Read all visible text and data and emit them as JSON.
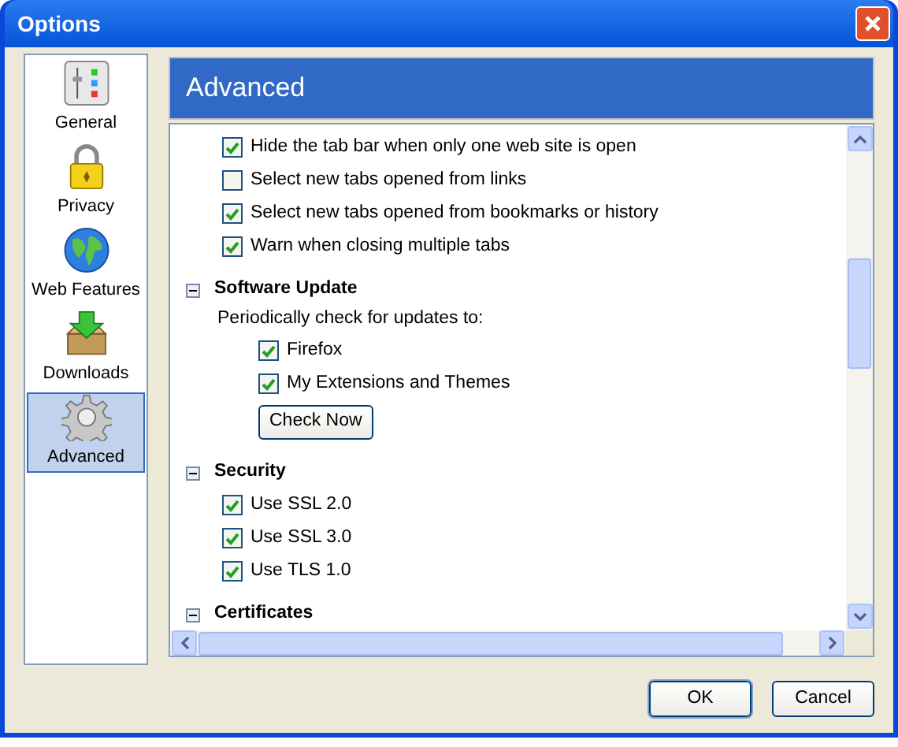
{
  "window": {
    "title": "Options"
  },
  "sidebar": {
    "items": [
      {
        "label": "General",
        "selected": false
      },
      {
        "label": "Privacy",
        "selected": false
      },
      {
        "label": "Web Features",
        "selected": false
      },
      {
        "label": "Downloads",
        "selected": false
      },
      {
        "label": "Advanced",
        "selected": true
      }
    ]
  },
  "panel": {
    "title": "Advanced",
    "items": [
      {
        "kind": "checkbox",
        "label": "Hide the tab bar when only one web site is open",
        "checked": true
      },
      {
        "kind": "checkbox",
        "label": "Select new tabs opened from links",
        "checked": false
      },
      {
        "kind": "checkbox",
        "label": "Select new tabs opened from bookmarks or history",
        "checked": true
      },
      {
        "kind": "checkbox",
        "label": "Warn when closing multiple tabs",
        "checked": true
      },
      {
        "kind": "section",
        "label": "Software Update",
        "expanded": true,
        "children": [
          {
            "kind": "text",
            "label": "Periodically check for updates to:",
            "children": [
              {
                "kind": "checkbox",
                "label": "Firefox",
                "checked": true
              },
              {
                "kind": "checkbox",
                "label": "My Extensions and Themes",
                "checked": true
              },
              {
                "kind": "button",
                "label": "Check Now"
              }
            ]
          }
        ]
      },
      {
        "kind": "section",
        "label": "Security",
        "expanded": true,
        "children": [
          {
            "kind": "checkbox",
            "label": "Use SSL 2.0",
            "checked": true
          },
          {
            "kind": "checkbox",
            "label": "Use SSL 3.0",
            "checked": true
          },
          {
            "kind": "checkbox",
            "label": "Use TLS 1.0",
            "checked": true
          }
        ]
      },
      {
        "kind": "section",
        "label": "Certificates",
        "expanded": true
      }
    ]
  },
  "buttons": [
    "OK",
    "Cancel"
  ]
}
